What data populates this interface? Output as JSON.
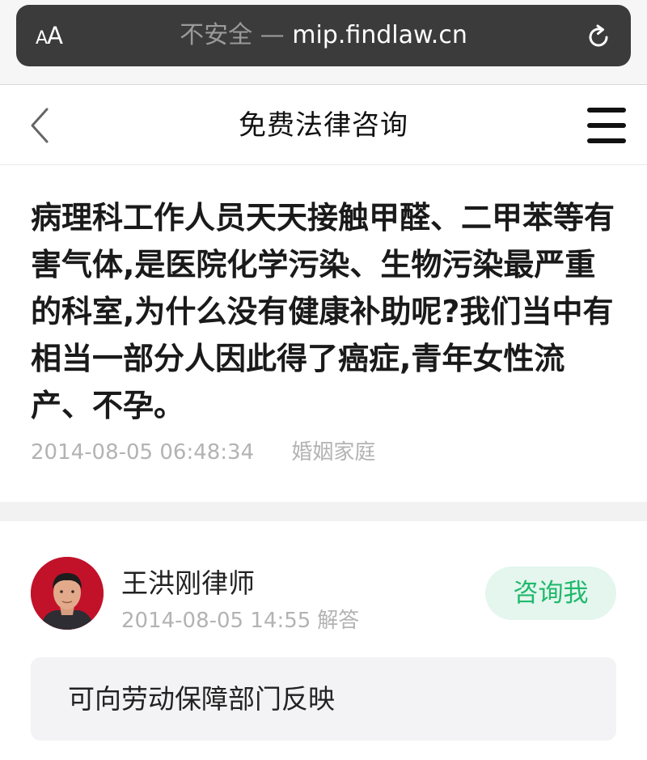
{
  "browser": {
    "aa_label_small": "A",
    "aa_label_large": "A",
    "url_security": "不安全",
    "url_separator": "—",
    "url_domain": "mip.findlaw.cn",
    "reload_icon": "reload-icon"
  },
  "header": {
    "back_icon": "chevron-left-icon",
    "title": "免费法律咨询",
    "menu_icon": "hamburger-menu-icon"
  },
  "question": {
    "title": "病理科工作人员天天接触甲醛、二甲苯等有害气体,是医院化学污染、生物污染最严重的科室,为什么没有健康补助呢?我们当中有相当一部分人因此得了癌症,青年女性流产、不孕。",
    "datetime": "2014-08-05 06:48:34",
    "category": "婚姻家庭"
  },
  "answer": {
    "lawyer_name": "王洪刚律师",
    "datetime": "2014-08-05 14:55",
    "tag": "解答",
    "consult_button": "咨询我",
    "content": "可向劳动保障部门反映"
  },
  "colors": {
    "accent_green": "#21b96c",
    "consult_bg": "#e4f6ee",
    "avatar_bg": "#c2122a",
    "address_bar_bg": "#3b3b3b"
  }
}
